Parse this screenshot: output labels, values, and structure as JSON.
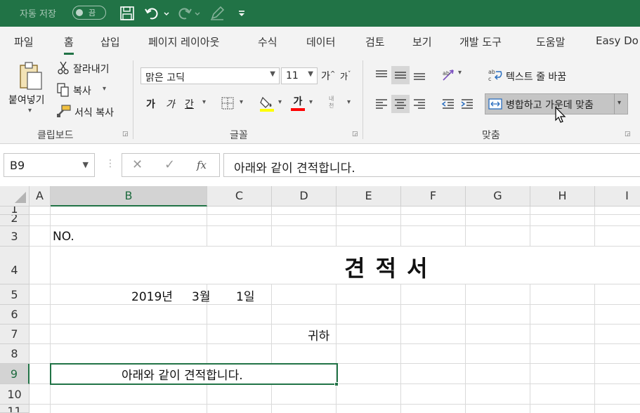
{
  "titlebar": {
    "autosave_label": "자동 저장",
    "autosave_state": "끔"
  },
  "tabs": [
    "파일",
    "홈",
    "삽입",
    "페이지 레이아웃",
    "수식",
    "데이터",
    "검토",
    "보기",
    "개발 도구",
    "도움말",
    "Easy Do"
  ],
  "ribbon": {
    "clipboard": {
      "paste": "붙여넣기",
      "cut": "잘라내기",
      "copy": "복사",
      "format_painter": "서식 복사",
      "group_label": "클립보드"
    },
    "font": {
      "font_name": "맑은 고딕",
      "font_size": "11",
      "grow": "가",
      "shrink": "가",
      "bold": "가",
      "italic": "가",
      "underline": "간",
      "font_color_glyph": "가",
      "phonetic": "내천",
      "group_label": "글꼴"
    },
    "alignment": {
      "wrap_text": "텍스트 줄 바꿈",
      "merge_center": "병합하고 가운데 맞춤",
      "group_label": "맞춤"
    }
  },
  "formula_bar": {
    "name_box": "B9",
    "cancel": "✕",
    "enter": "✓",
    "fx": "fx",
    "value": "아래와 같이 견적합니다."
  },
  "columns": [
    "A",
    "B",
    "C",
    "D",
    "E",
    "F",
    "G",
    "H",
    "I"
  ],
  "rows": [
    "1",
    "2",
    "3",
    "4",
    "5",
    "6",
    "7",
    "8",
    "9",
    "10",
    "11"
  ],
  "cells": {
    "b3": "NO.",
    "title": "견 적 서",
    "date_year": "2019년",
    "date_month": "3월",
    "date_day": "1일",
    "honorific": "귀하",
    "b9": "아래와 같이 견적합니다."
  },
  "colors": {
    "excel_green": "#217346",
    "highlight_yellow": "#ffff00",
    "font_red": "#ff0000"
  }
}
